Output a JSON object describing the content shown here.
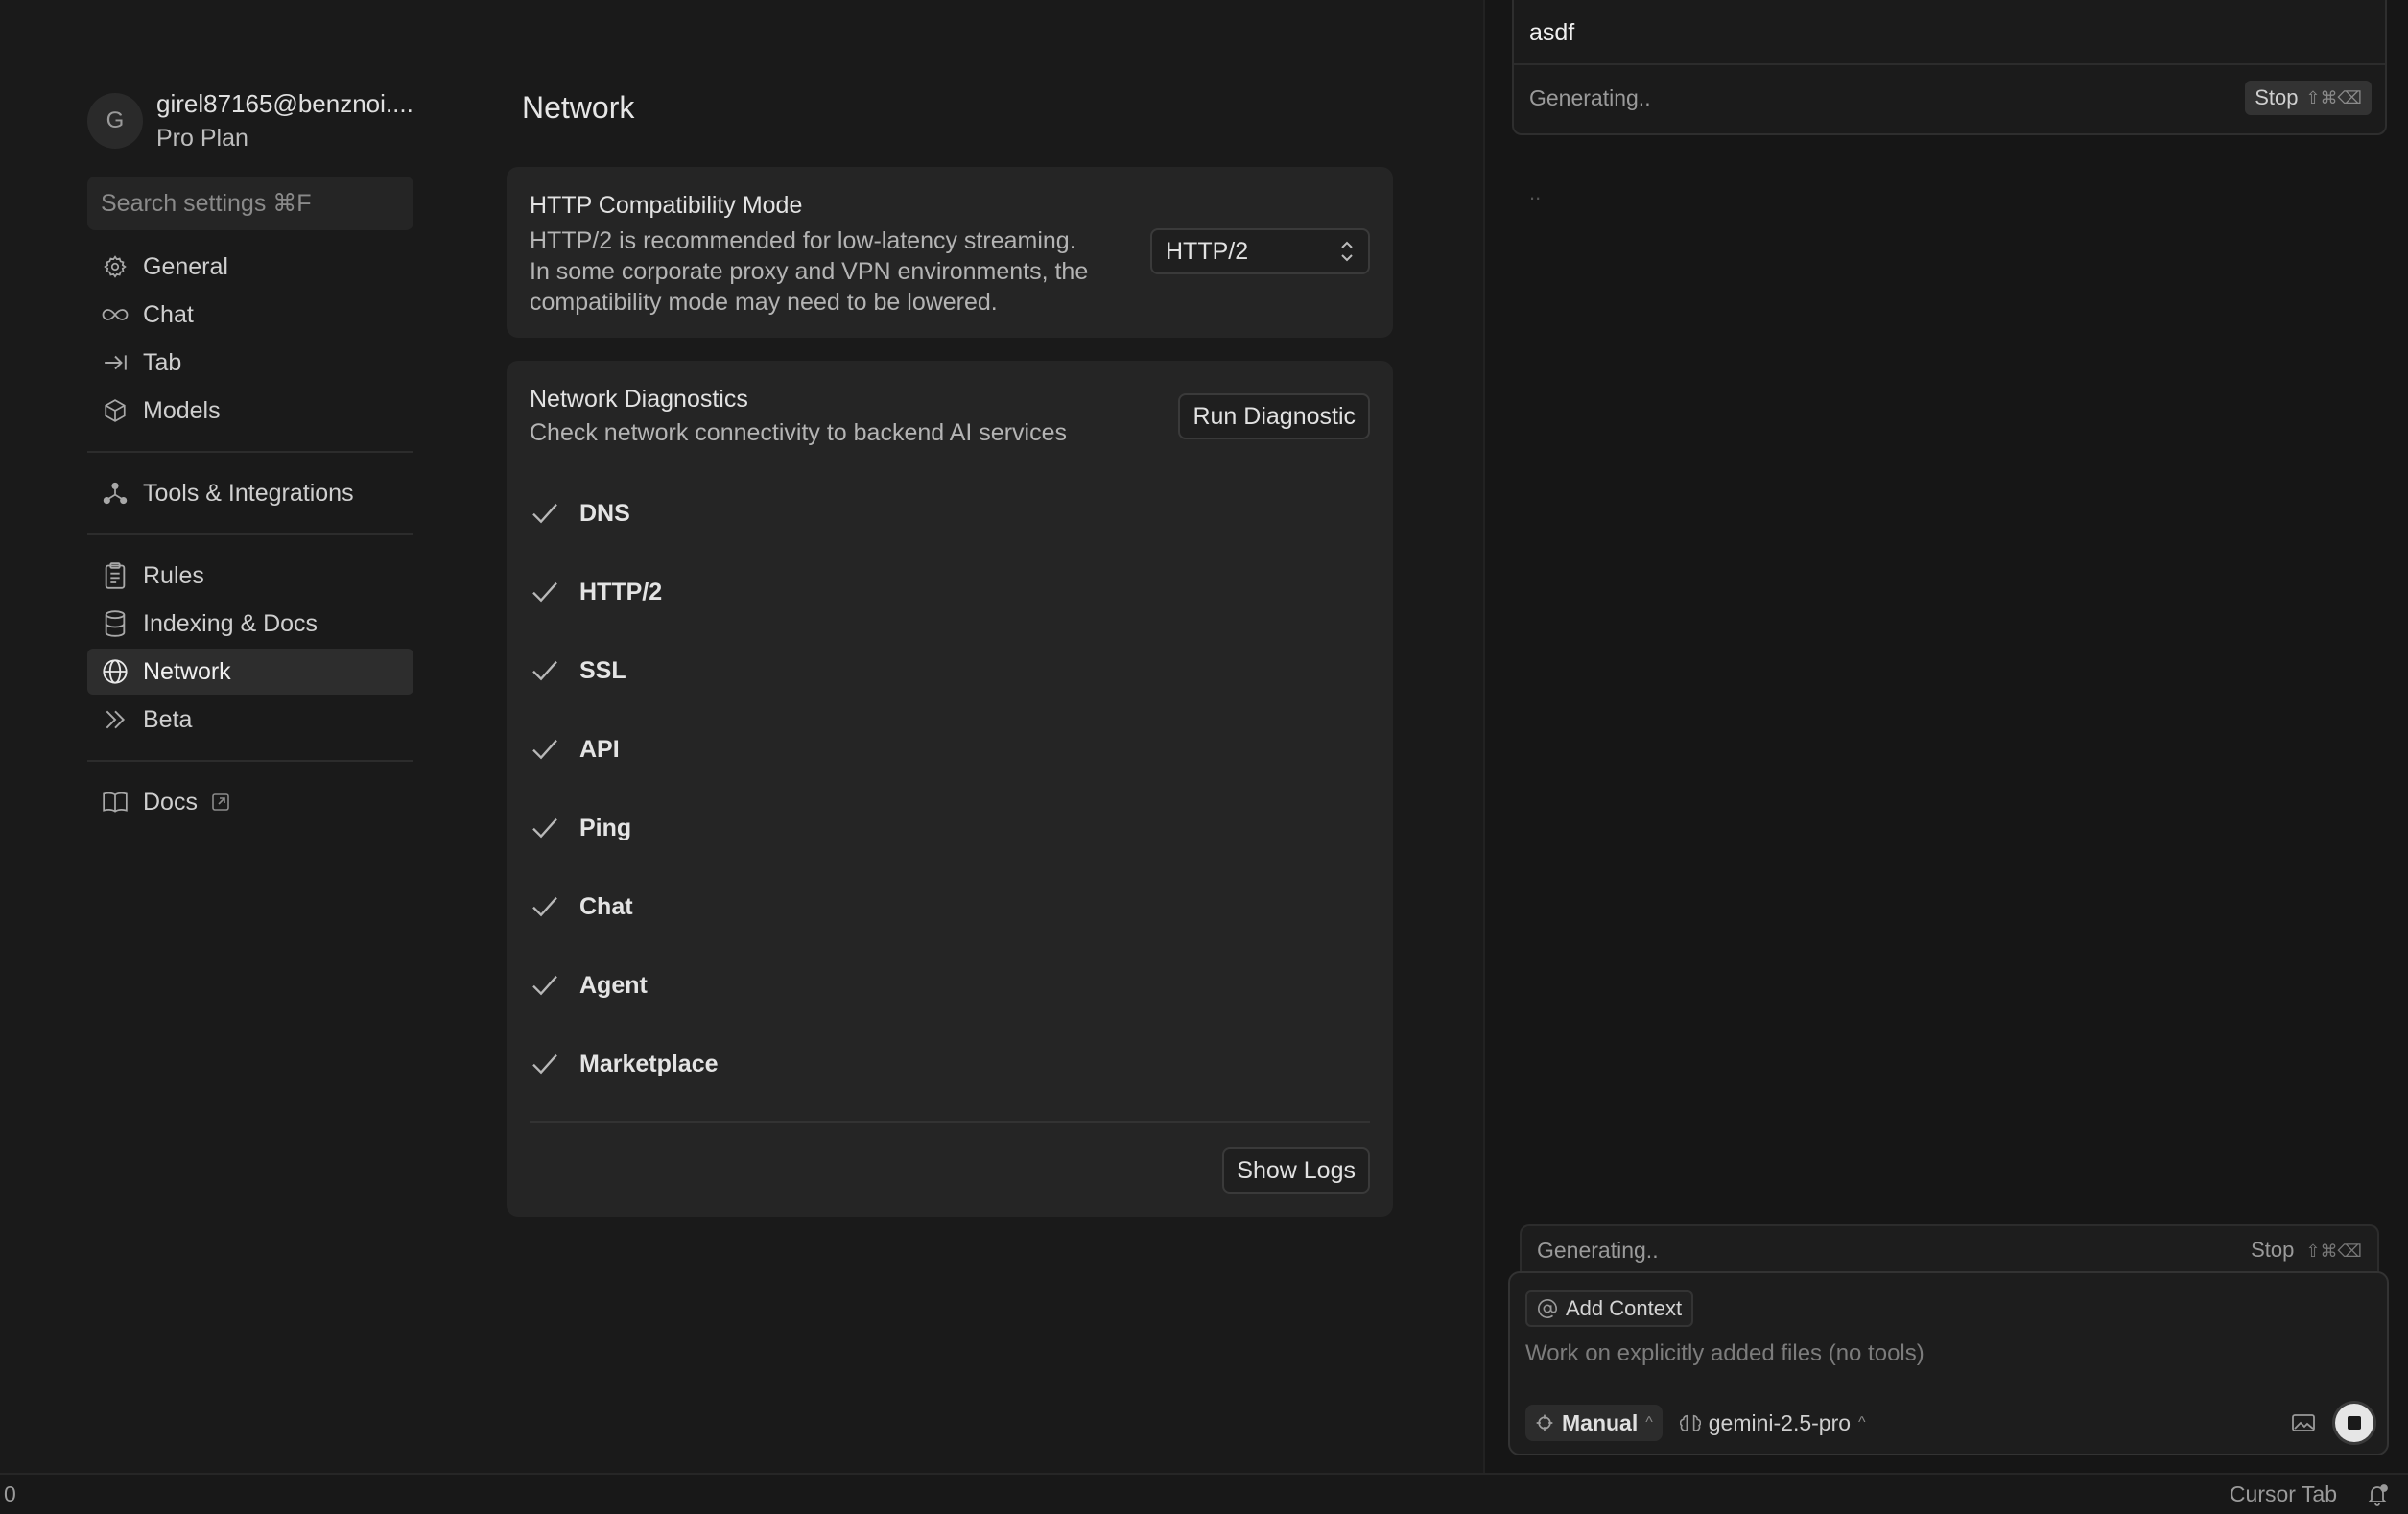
{
  "sidebar": {
    "avatar_letter": "G",
    "email": "girel87165@benznoi....",
    "plan": "Pro Plan",
    "search_placeholder": "Search settings ⌘F",
    "items": [
      {
        "label": "General",
        "icon": "gear-icon"
      },
      {
        "label": "Chat",
        "icon": "infinity-icon"
      },
      {
        "label": "Tab",
        "icon": "arrow-right-bar-icon"
      },
      {
        "label": "Models",
        "icon": "cube-icon"
      },
      {
        "label": "Tools & Integrations",
        "icon": "nodes-icon"
      },
      {
        "label": "Rules",
        "icon": "clipboard-icon"
      },
      {
        "label": "Indexing & Docs",
        "icon": "database-icon"
      },
      {
        "label": "Network",
        "icon": "globe-icon",
        "active": true
      },
      {
        "label": "Beta",
        "icon": "double-chevron-icon"
      },
      {
        "label": "Docs",
        "icon": "book-icon",
        "external": true
      }
    ]
  },
  "main": {
    "title": "Network",
    "http_card": {
      "title": "HTTP Compatibility Mode",
      "desc_line1": "HTTP/2 is recommended for low-latency streaming.",
      "desc_line2": "In some corporate proxy and VPN environments, the",
      "desc_line3": "compatibility mode may need to be lowered.",
      "select_value": "HTTP/2"
    },
    "diag_card": {
      "title": "Network Diagnostics",
      "desc": "Check network connectivity to backend AI services",
      "run_button": "Run Diagnostic",
      "checks": [
        "DNS",
        "HTTP/2",
        "SSL",
        "API",
        "Ping",
        "Chat",
        "Agent",
        "Marketplace"
      ],
      "show_logs_button": "Show Logs"
    }
  },
  "chat": {
    "user_message": "asdf",
    "generating_text": "Generating..",
    "stop_label": "Stop",
    "stop_shortcut": "⇧⌘⌫",
    "ellipsis": "..",
    "add_context_label": "Add Context",
    "placeholder": "Work on explicitly added files (no tools)",
    "mode_label": "Manual",
    "model_label": "gemini-2.5-pro"
  },
  "status_bar": {
    "left": "0",
    "right": "Cursor Tab"
  },
  "colors": {
    "background": "#1a1a1a",
    "card": "#252525",
    "active_nav": "#2d2d2d"
  }
}
